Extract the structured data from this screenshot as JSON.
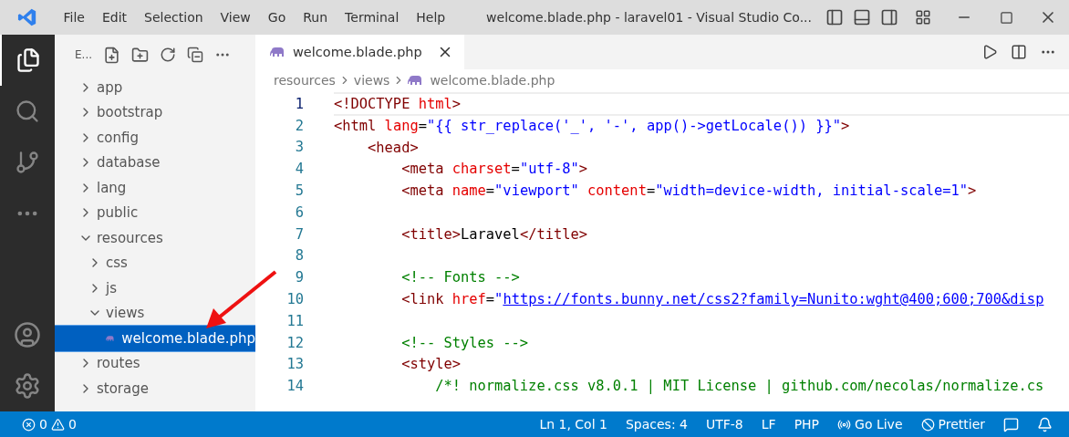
{
  "window": {
    "title": "welcome.blade.php - laravel01 - Visual Studio Co..."
  },
  "menu": [
    "File",
    "Edit",
    "Selection",
    "View",
    "Go",
    "Run",
    "Terminal",
    "Help"
  ],
  "explorer": {
    "title": "E...",
    "tree": [
      {
        "label": "app",
        "kind": "folder",
        "expanded": false,
        "selected": false
      },
      {
        "label": "bootstrap",
        "kind": "folder",
        "expanded": false,
        "selected": false
      },
      {
        "label": "config",
        "kind": "folder",
        "expanded": false,
        "selected": false
      },
      {
        "label": "database",
        "kind": "folder",
        "expanded": false,
        "selected": false
      },
      {
        "label": "lang",
        "kind": "folder",
        "expanded": false,
        "selected": false
      },
      {
        "label": "public",
        "kind": "folder",
        "expanded": false,
        "selected": false
      },
      {
        "label": "resources",
        "kind": "folder",
        "expanded": true,
        "selected": false,
        "children": [
          {
            "label": "css",
            "kind": "folder",
            "expanded": false,
            "selected": false
          },
          {
            "label": "js",
            "kind": "folder",
            "expanded": false,
            "selected": false
          },
          {
            "label": "views",
            "kind": "folder",
            "expanded": true,
            "selected": false,
            "children": [
              {
                "label": "welcome.blade.php",
                "kind": "file",
                "selected": true
              }
            ]
          }
        ]
      },
      {
        "label": "routes",
        "kind": "folder",
        "expanded": false,
        "selected": false
      },
      {
        "label": "storage",
        "kind": "folder",
        "expanded": false,
        "selected": false
      }
    ]
  },
  "tabs": [
    {
      "label": "welcome.blade.php",
      "selected": true
    }
  ],
  "breadcrumb": [
    "resources",
    "views",
    "welcome.blade.php"
  ],
  "code": [
    {
      "n": "1",
      "current": true,
      "tokens": [
        {
          "kind": "tag",
          "text": "<!DOCTYPE"
        },
        {
          "kind": "attr",
          "text": " html"
        },
        {
          "kind": "tag",
          "text": ">"
        }
      ]
    },
    {
      "n": "2",
      "current": false,
      "tokens": [
        {
          "kind": "tag",
          "text": "<html"
        },
        {
          "kind": "attr",
          "text": " lang"
        },
        {
          "kind": "text",
          "text": "="
        },
        {
          "kind": "string",
          "text": "\"{{ str_replace('_', '-', app()->getLocale()) }}\""
        },
        {
          "kind": "tag",
          "text": ">"
        }
      ]
    },
    {
      "n": "3",
      "current": false,
      "tokens": [
        {
          "kind": "tag",
          "text": "    <head>"
        }
      ]
    },
    {
      "n": "4",
      "current": false,
      "tokens": [
        {
          "kind": "tag",
          "text": "        <meta"
        },
        {
          "kind": "attr",
          "text": " charset"
        },
        {
          "kind": "text",
          "text": "="
        },
        {
          "kind": "string",
          "text": "\"utf-8\""
        },
        {
          "kind": "tag",
          "text": ">"
        }
      ]
    },
    {
      "n": "5",
      "current": false,
      "tokens": [
        {
          "kind": "tag",
          "text": "        <meta"
        },
        {
          "kind": "attr",
          "text": " name"
        },
        {
          "kind": "text",
          "text": "="
        },
        {
          "kind": "string",
          "text": "\"viewport\""
        },
        {
          "kind": "attr",
          "text": " content"
        },
        {
          "kind": "text",
          "text": "="
        },
        {
          "kind": "string",
          "text": "\"width=device-width, initial-scale=1\""
        },
        {
          "kind": "tag",
          "text": ">"
        }
      ]
    },
    {
      "n": "6",
      "current": false
    },
    {
      "n": "7",
      "current": false,
      "tokens": [
        {
          "kind": "tag",
          "text": "        <title>"
        },
        {
          "kind": "text",
          "text": "Laravel"
        },
        {
          "kind": "tag",
          "text": "</title>"
        }
      ]
    },
    {
      "n": "8",
      "current": false
    },
    {
      "n": "9",
      "current": false,
      "tokens": [
        {
          "kind": "comment",
          "text": "        <!-- Fonts -->"
        }
      ]
    },
    {
      "n": "10",
      "current": false,
      "tokens": [
        {
          "kind": "tag",
          "text": "        <link"
        },
        {
          "kind": "attr",
          "text": " href"
        },
        {
          "kind": "text",
          "text": "="
        },
        {
          "kind": "string",
          "text": "\""
        },
        {
          "kind": "link",
          "text": "https://fonts.bunny.net/css2?family=Nunito:wght@400;600;700&disp"
        }
      ]
    },
    {
      "n": "11",
      "current": false
    },
    {
      "n": "12",
      "current": false,
      "tokens": [
        {
          "kind": "comment",
          "text": "        <!-- Styles -->"
        }
      ]
    },
    {
      "n": "13",
      "current": false,
      "tokens": [
        {
          "kind": "tag",
          "text": "        <style>"
        }
      ]
    },
    {
      "n": "14",
      "current": false,
      "tokens": [
        {
          "kind": "comment",
          "text": "            /*! normalize.css v8.0.1 | MIT License | github.com/necolas/normalize.cs"
        }
      ]
    }
  ],
  "status": {
    "errors": "0",
    "warnings": "0",
    "items": [
      "Ln 1, Col 1",
      "Spaces: 4",
      "UTF-8",
      "LF",
      "PHP"
    ],
    "go_live": "Go Live",
    "prettier": "Prettier"
  }
}
